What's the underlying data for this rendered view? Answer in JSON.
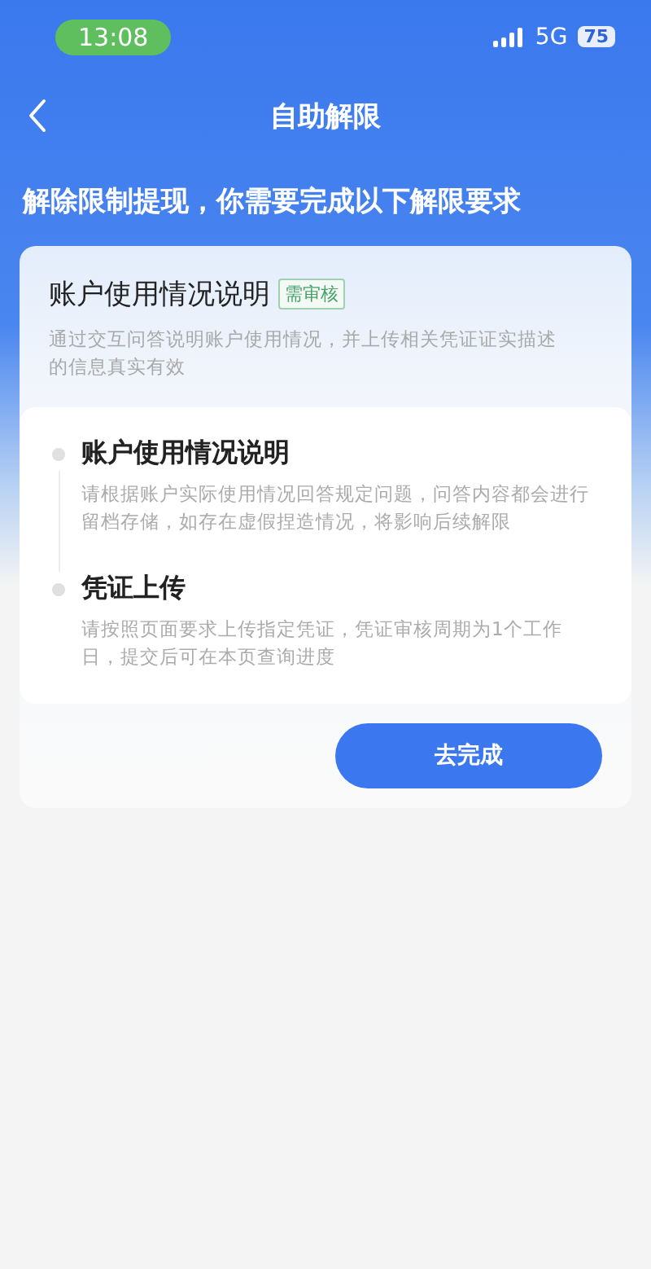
{
  "status_bar": {
    "time": "13:08",
    "network": "5G",
    "battery": "75"
  },
  "nav": {
    "title": "自助解限"
  },
  "headline": "解除限制提现，你需要完成以下解限要求",
  "card": {
    "title": "账户使用情况说明",
    "badge": "需审核",
    "description": "通过交互问答说明账户使用情况，并上传相关凭证证实描述的信息真实有效",
    "steps": [
      {
        "title": "账户使用情况说明",
        "description": "请根据账户实际使用情况回答规定问题，问答内容都会进行留档存储，如存在虚假捏造情况，将影响后续解限"
      },
      {
        "title": "凭证上传",
        "description": "请按照页面要求上传指定凭证，凭证审核周期为1个工作日，提交后可在本页查询进度"
      }
    ],
    "button": "去完成"
  }
}
